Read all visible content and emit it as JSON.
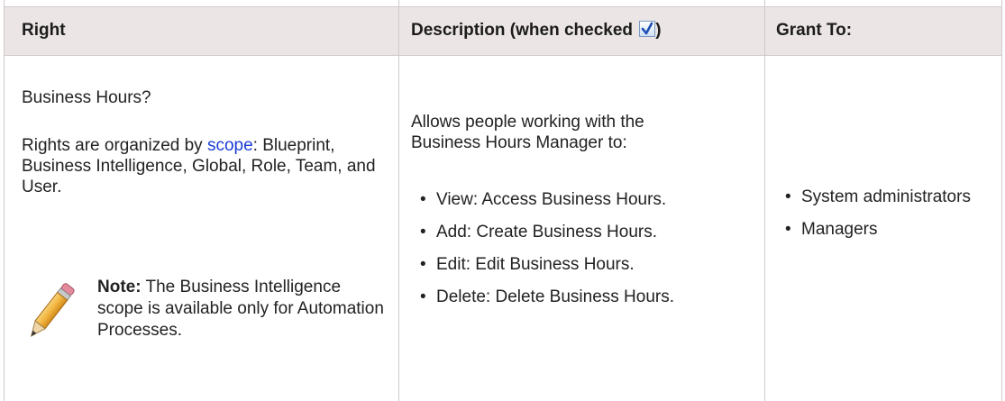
{
  "headers": {
    "right": "Right",
    "description": "Description (when checked",
    "description_close": ")",
    "grant_to": "Grant To:"
  },
  "right_cell": {
    "title": "Business Hours?",
    "scope_intro": "Rights are organized by ",
    "scope_link": "scope",
    "scope_rest": ": Blueprint, Business Intelligence, Global, Role, Team, and User.",
    "note_label": "Note:",
    "note_text": " The Business Intelligence scope is available only for Automation Processes."
  },
  "description_cell": {
    "intro": "Allows people working with the Business Hours Manager to:",
    "items": [
      "View: Access Business Hours.",
      "Add: Create Business Hours.",
      "Edit: Edit Business Hours.",
      "Delete: Delete Business Hours."
    ]
  },
  "grant_cell": {
    "items": [
      "System administrators",
      "Managers"
    ]
  },
  "colors": {
    "header_bg": "#ece5e5",
    "border": "#cfcaca",
    "link": "#1a3cd6"
  },
  "icons": {
    "checkbox": "checked-checkbox-icon",
    "pencil": "pencil-icon"
  }
}
